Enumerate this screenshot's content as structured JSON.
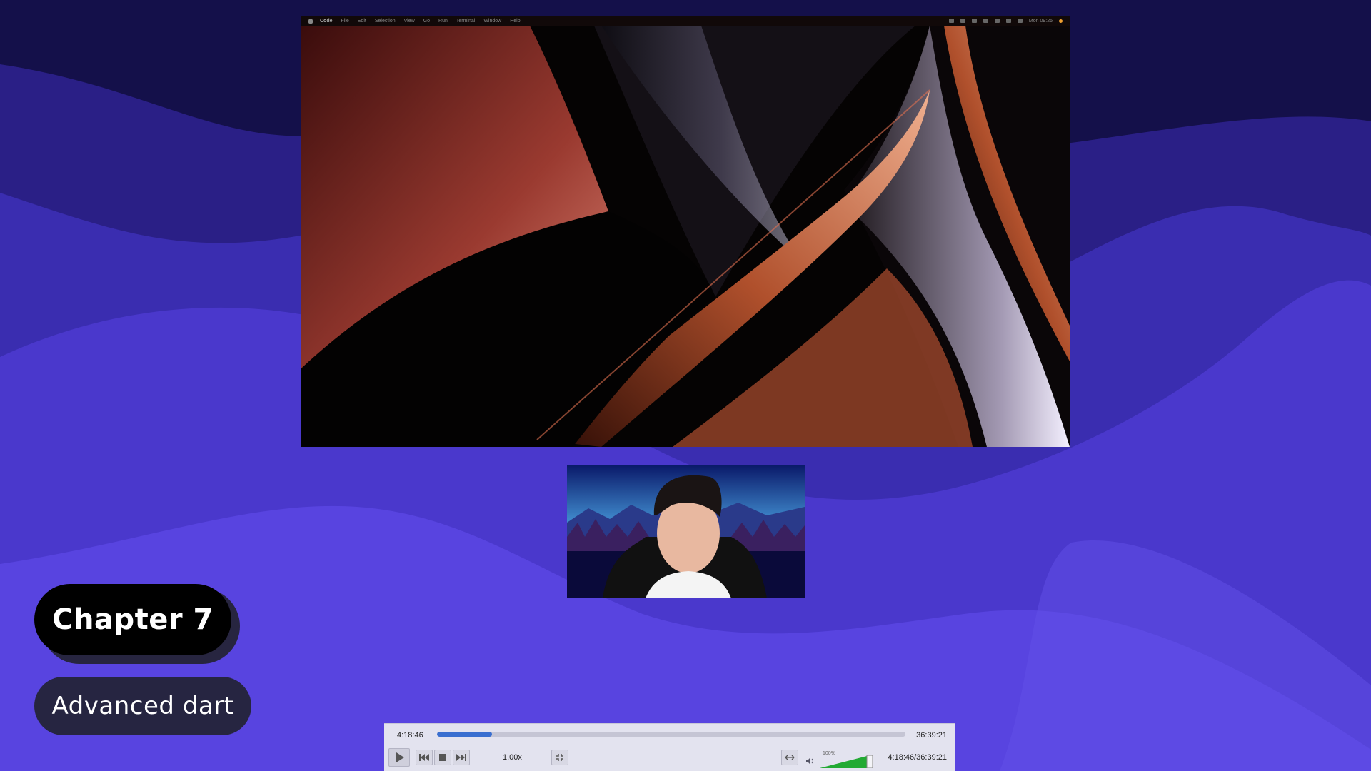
{
  "screen": {
    "menubar": {
      "app_name": "Code",
      "items": [
        "File",
        "Edit",
        "Selection",
        "View",
        "Go",
        "Run",
        "Terminal",
        "Window",
        "Help"
      ],
      "clock": "Mon 09:25"
    }
  },
  "badges": {
    "chapter": "Chapter 7",
    "topic": "Advanced dart"
  },
  "player": {
    "current_time": "4:18:46",
    "total_time": "36:39:21",
    "progress": 0.118,
    "speed": "1.00x",
    "volume_label": "100%",
    "volume": 1.0,
    "time_combo": "4:18:46/36:39:21",
    "icons": {
      "play": "play-icon",
      "previous": "skip-back-icon",
      "stop": "stop-icon",
      "next": "skip-forward-icon",
      "fit": "fit-screen-icon",
      "stretch": "stretch-icon",
      "speaker": "speaker-icon"
    }
  },
  "colors": {
    "background_dark": "#1a1456",
    "background_mid": "#3a2db0",
    "background_light": "#5a44e0",
    "progress": "#3a6fd0",
    "volume": "#22aa33"
  }
}
